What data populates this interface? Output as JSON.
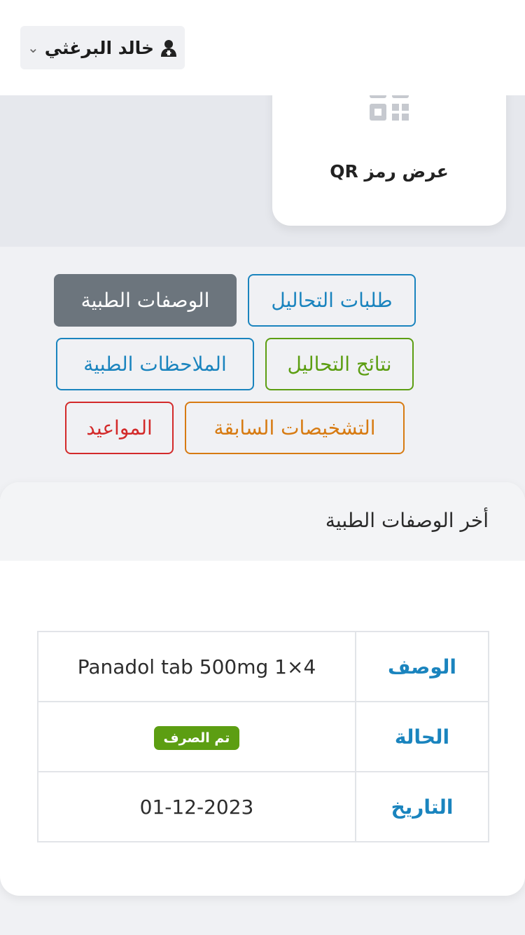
{
  "header": {
    "user_name": "خالد البرغثي",
    "user_icon": "user-doctor-icon",
    "dropdown_icon": "chevron-down-icon"
  },
  "qr": {
    "label": "عرض رمز QR",
    "icon": "qr-code-icon"
  },
  "tabs": [
    {
      "label": "طلبات التحاليل",
      "color": "#1a84be",
      "active": false
    },
    {
      "label": "الوصفات الطبية",
      "color": "#6c757d",
      "active": true
    },
    {
      "label": "نتائج التحاليل",
      "color": "#5c9e12",
      "active": false
    },
    {
      "label": "الملاحظات الطبية",
      "color": "#1a84be",
      "active": false
    },
    {
      "label": "التشخيصات السابقة",
      "color": "#d77b12",
      "active": false
    },
    {
      "label": "المواعيد",
      "color": "#d32a2a",
      "active": false
    }
  ],
  "prescriptions": {
    "title": "أخر الوصفات الطبية",
    "rows": [
      {
        "label": "الوصف",
        "value": "Panadol tab 500mg 1×4"
      },
      {
        "label": "الحالة",
        "value": "تم الصرف"
      },
      {
        "label": "التاريخ",
        "value": "01-12-2023"
      }
    ]
  },
  "colors": {
    "accent": "#1a84be",
    "status_success": "#5c9e12"
  }
}
